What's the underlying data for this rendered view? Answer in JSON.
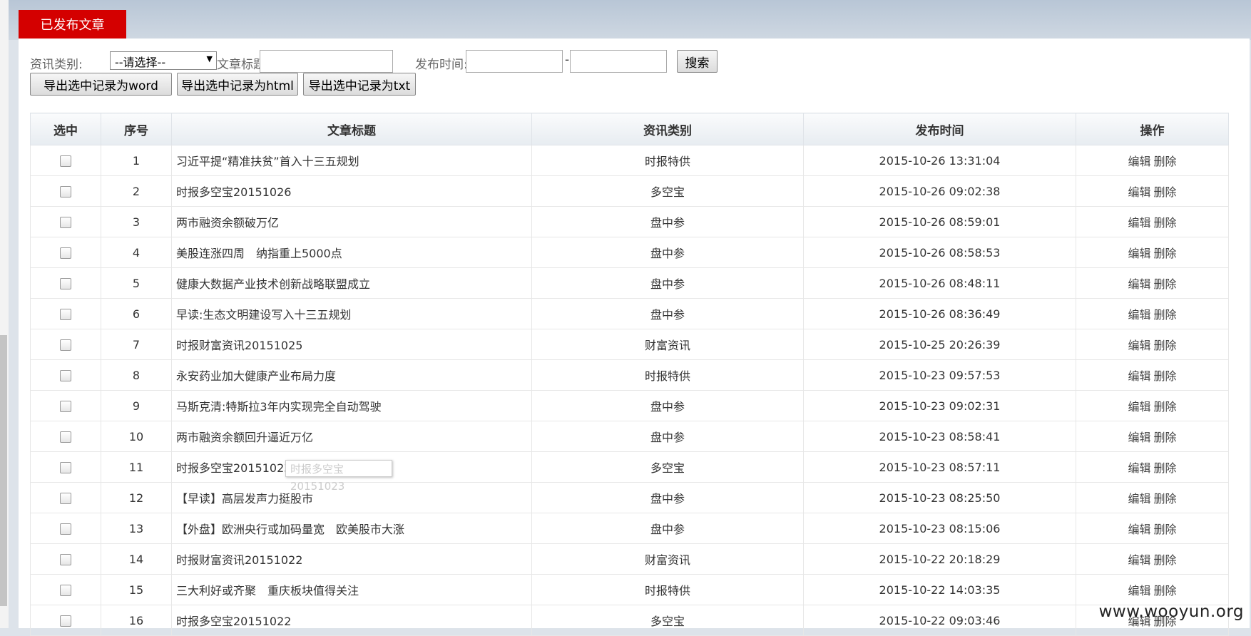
{
  "tab": {
    "label": "已发布文章"
  },
  "filters": {
    "category_label": "资讯类别:",
    "category_selected": "--请选择--",
    "title_label": "文章标题:",
    "title_value": "",
    "time_label": "发布时间:",
    "time_from": "",
    "time_separator": "-",
    "time_to": "",
    "search_label": "搜索"
  },
  "export": {
    "word": "导出选中记录为word",
    "html": "导出选中记录为html",
    "txt": "导出选中记录为txt"
  },
  "table": {
    "headers": [
      "选中",
      "序号",
      "文章标题",
      "资讯类别",
      "发布时间",
      "操作"
    ],
    "actions": {
      "edit": "编辑",
      "delete": "删除"
    },
    "rows": [
      {
        "no": "1",
        "title": "习近平提“精准扶贫”首入十三五规划",
        "category": "时报特供",
        "time": "2015-10-26 13:31:04"
      },
      {
        "no": "2",
        "title": "时报多空宝20151026",
        "category": "多空宝",
        "time": "2015-10-26 09:02:38"
      },
      {
        "no": "3",
        "title": "两市融资余额破万亿",
        "category": "盘中参",
        "time": "2015-10-26 08:59:01"
      },
      {
        "no": "4",
        "title": "美股连涨四周　纳指重上5000点",
        "category": "盘中参",
        "time": "2015-10-26 08:58:53"
      },
      {
        "no": "5",
        "title": "健康大数据产业技术创新战略联盟成立",
        "category": "盘中参",
        "time": "2015-10-26 08:48:11"
      },
      {
        "no": "6",
        "title": "早读:生态文明建设写入十三五规划",
        "category": "盘中参",
        "time": "2015-10-26 08:36:49"
      },
      {
        "no": "7",
        "title": "时报财富资讯20151025",
        "category": "财富资讯",
        "time": "2015-10-25 20:26:39"
      },
      {
        "no": "8",
        "title": "永安药业加大健康产业布局力度",
        "category": "时报特供",
        "time": "2015-10-23 09:57:53"
      },
      {
        "no": "9",
        "title": "马斯克清:特斯拉3年内实现完全自动驾驶",
        "category": "盘中参",
        "time": "2015-10-23 09:02:31"
      },
      {
        "no": "10",
        "title": "两市融资余额回升逼近万亿",
        "category": "盘中参",
        "time": "2015-10-23 08:58:41"
      },
      {
        "no": "11",
        "title": "时报多空宝20151023",
        "category": "多空宝",
        "time": "2015-10-23 08:57:11"
      },
      {
        "no": "12",
        "title": "【早读】高层发声力挺股市",
        "category": "盘中参",
        "time": "2015-10-23 08:25:50"
      },
      {
        "no": "13",
        "title": "【外盘】欧洲央行或加码量宽　欧美股市大涨",
        "category": "盘中参",
        "time": "2015-10-23 08:15:06"
      },
      {
        "no": "14",
        "title": "时报财富资讯20151022",
        "category": "财富资讯",
        "time": "2015-10-22 20:18:29"
      },
      {
        "no": "15",
        "title": "三大利好或齐聚　重庆板块值得关注",
        "category": "时报特供",
        "time": "2015-10-22 14:03:35"
      },
      {
        "no": "16",
        "title": "时报多空宝20151022",
        "category": "多空宝",
        "time": "2015-10-22 09:03:46"
      }
    ]
  },
  "tooltip": {
    "text": "时报多空宝20151023"
  },
  "watermark": {
    "text": "www.wooyun.org"
  }
}
